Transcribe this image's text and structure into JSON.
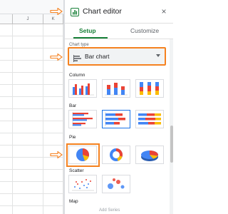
{
  "sheet": {
    "columns": [
      "",
      "J",
      "K"
    ]
  },
  "editor": {
    "title": "Chart editor",
    "close_glyph": "×",
    "tabs": [
      {
        "label": "Setup",
        "active": true
      },
      {
        "label": "Customize",
        "active": false
      }
    ],
    "chart_type": {
      "label": "Chart type",
      "value": "Bar chart"
    },
    "sections": [
      {
        "label": "Column",
        "options": [
          "column-chart-icon",
          "stacked-column-chart-icon",
          "100-stacked-column-chart-icon"
        ]
      },
      {
        "label": "Bar",
        "options": [
          "bar-chart-icon",
          "stacked-bar-chart-icon",
          "100-stacked-bar-chart-icon"
        ]
      },
      {
        "label": "Pie",
        "options": [
          "pie-chart-icon",
          "donut-chart-icon",
          "3d-pie-chart-icon"
        ]
      },
      {
        "label": "Scatter",
        "options": [
          "scatter-chart-icon",
          "bubble-chart-icon"
        ]
      },
      {
        "label": "Map",
        "options": []
      }
    ],
    "footer_text": "Add Series"
  },
  "colors": {
    "accent_green": "#188038",
    "highlight_orange": "#f58220",
    "series_blue": "#4285f4",
    "series_red": "#ea4335",
    "series_yellow": "#fbbc04",
    "selected_blue": "#1a73e8"
  }
}
